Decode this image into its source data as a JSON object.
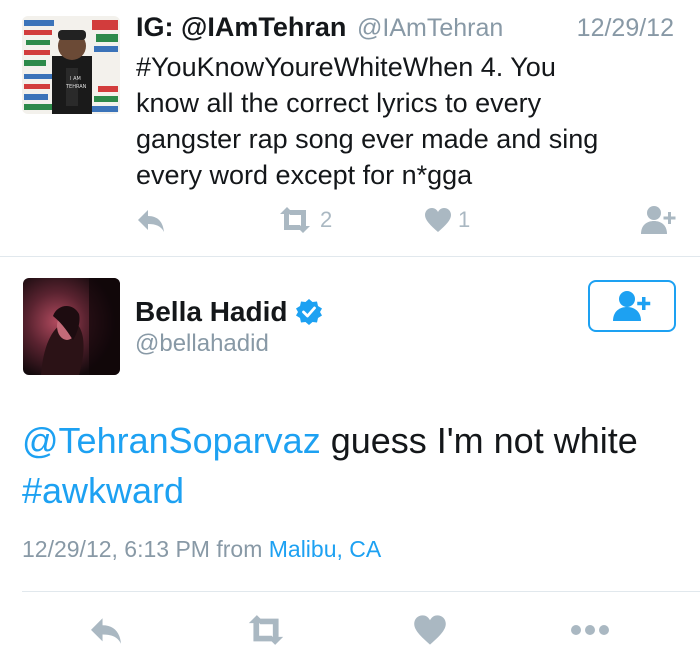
{
  "tweet1": {
    "author_name": "IG: @IAmTehran",
    "author_handle": "@IAmTehran",
    "date": "12/29/12",
    "text": "#YouKnowYoureWhiteWhen  4.  You\nknow all the correct lyrics to every\ngangster rap song ever made and sing\nevery word except for n*gga",
    "retweet_count": "2",
    "like_count": "1",
    "avatar_lettering": [
      "I AM TEHRAN"
    ],
    "icons": [
      "reply-icon",
      "retweet-icon",
      "heart-icon",
      "follow-icon"
    ]
  },
  "tweet2": {
    "author_name": "Bella Hadid",
    "author_handle": "@bellahadid",
    "verified": true,
    "mention": "@TehranSoparvaz",
    "text_main": " guess I'm not white",
    "hashtag": "#awkward",
    "timestamp": "12/29/12, 6:13 PM from",
    "location": "Malibu, CA",
    "icons": [
      "reply-icon",
      "retweet-icon",
      "heart-icon",
      "more-icon",
      "follow-icon",
      "verified-badge-icon"
    ]
  },
  "colors": {
    "accent": "#1da1f2",
    "muted": "#8899a6",
    "icon": "#aab8c2",
    "text": "#14171a",
    "divider": "#e1e8ed"
  }
}
